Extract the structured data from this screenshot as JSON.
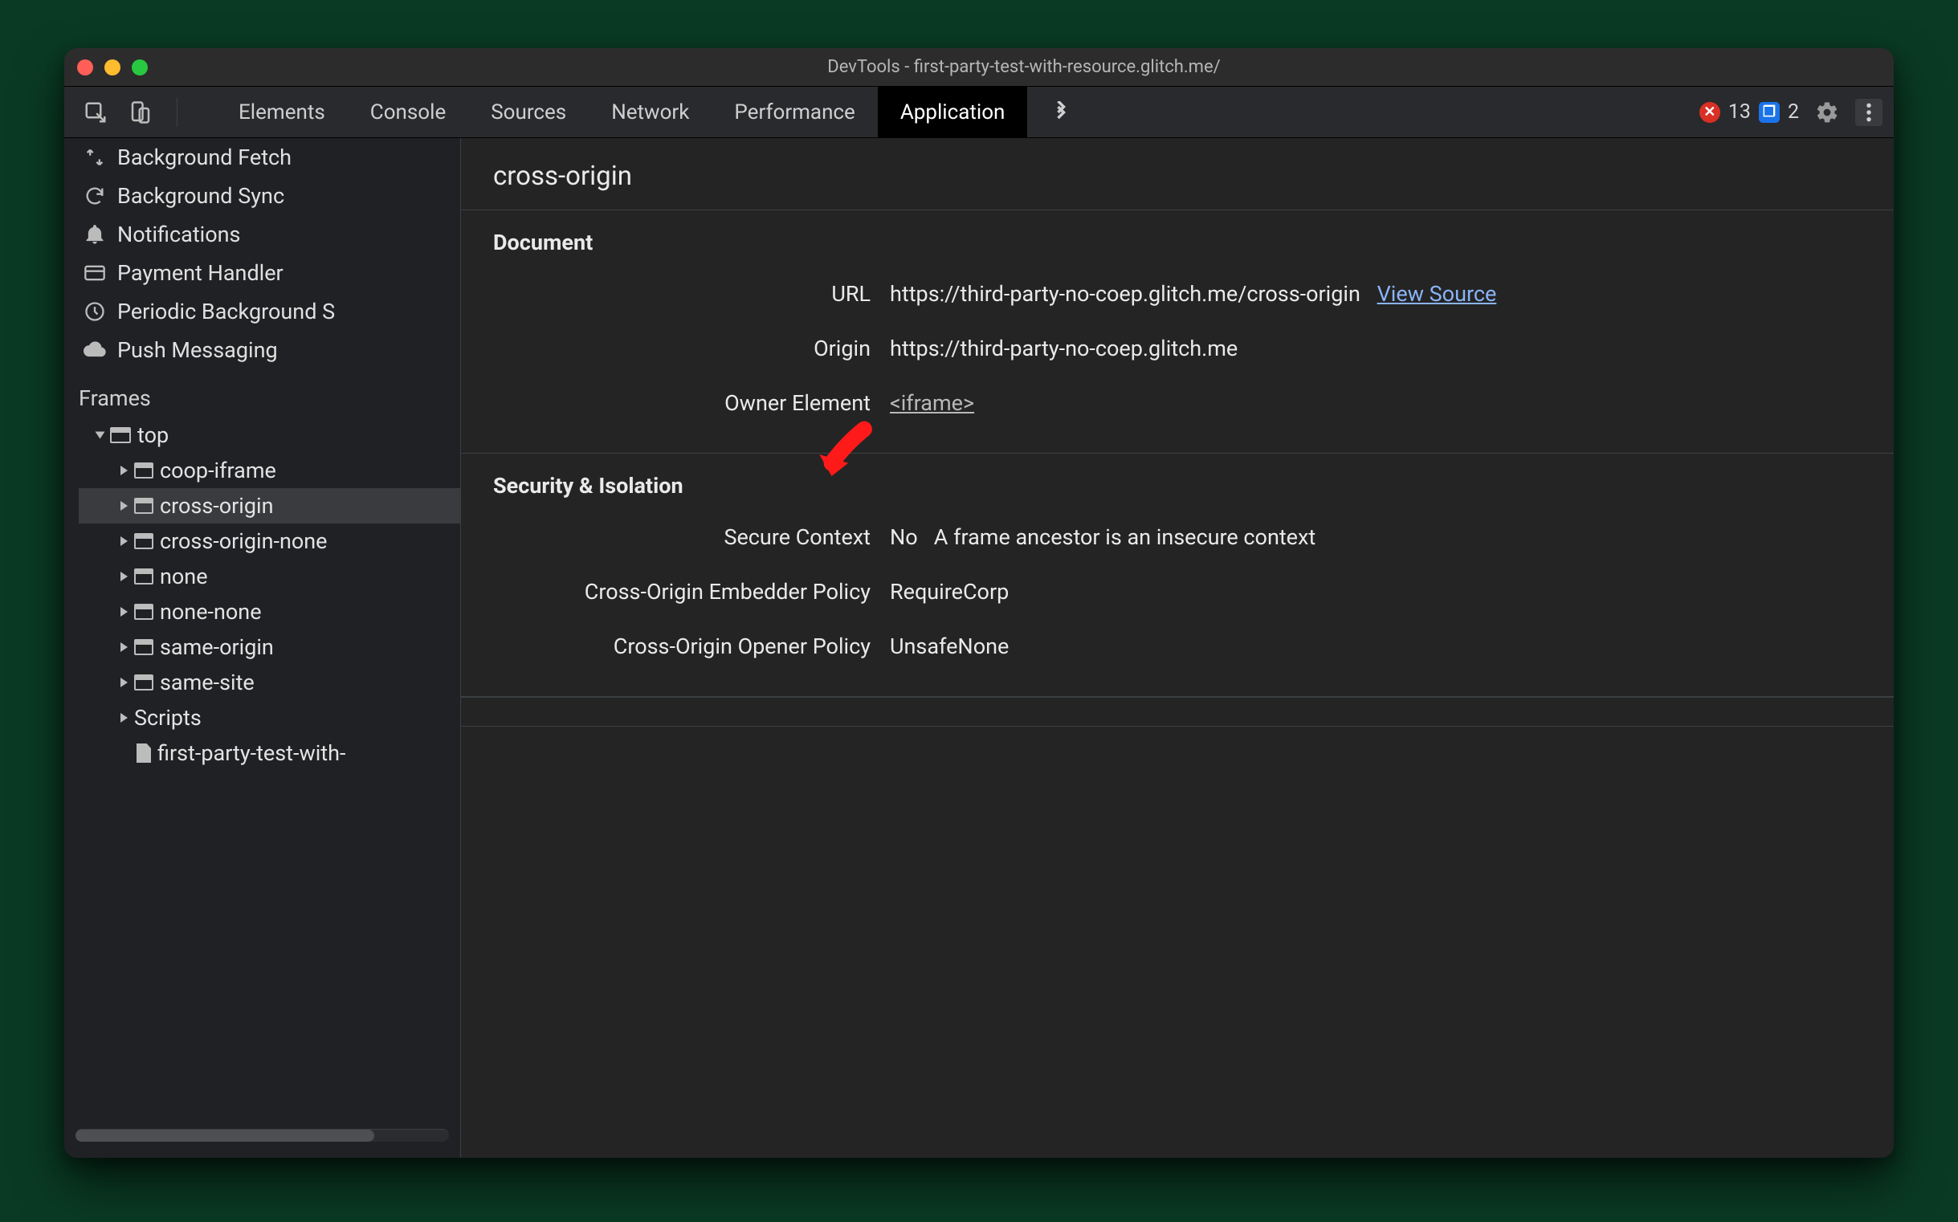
{
  "window": {
    "title": "DevTools - first-party-test-with-resource.glitch.me/"
  },
  "tabs": {
    "items": [
      "Elements",
      "Console",
      "Sources",
      "Network",
      "Performance",
      "Application"
    ],
    "activeIndex": 5
  },
  "issues": {
    "errors": 13,
    "messages": 2
  },
  "sidebar": {
    "services": [
      {
        "icon": "background-fetch-icon",
        "label": "Background Fetch"
      },
      {
        "icon": "background-sync-icon",
        "label": "Background Sync"
      },
      {
        "icon": "notifications-icon",
        "label": "Notifications"
      },
      {
        "icon": "payment-handler-icon",
        "label": "Payment Handler"
      },
      {
        "icon": "periodic-sync-icon",
        "label": "Periodic Background S"
      },
      {
        "icon": "push-messaging-icon",
        "label": "Push Messaging"
      }
    ],
    "framesTitle": "Frames",
    "frames": {
      "top": "top",
      "children": [
        "coop-iframe",
        "cross-origin",
        "cross-origin-none",
        "none",
        "none-none",
        "same-origin",
        "same-site"
      ],
      "selectedIndex": 1,
      "scripts": "Scripts",
      "scriptFile": "first-party-test-with-"
    }
  },
  "main": {
    "title": "cross-origin",
    "document": {
      "heading": "Document",
      "rows": {
        "url": {
          "k": "URL",
          "v": "https://third-party-no-coep.glitch.me/cross-origin",
          "link": "View Source"
        },
        "origin": {
          "k": "Origin",
          "v": "https://third-party-no-coep.glitch.me"
        },
        "owner": {
          "k": "Owner Element",
          "link": "<iframe>"
        }
      }
    },
    "security": {
      "heading": "Security & Isolation",
      "rows": {
        "secure": {
          "k": "Secure Context",
          "v": "No",
          "extra": "A frame ancestor is an insecure context"
        },
        "coep": {
          "k": "Cross-Origin Embedder Policy",
          "v": "RequireCorp"
        },
        "coop": {
          "k": "Cross-Origin Opener Policy",
          "v": "UnsafeNone"
        }
      }
    }
  }
}
